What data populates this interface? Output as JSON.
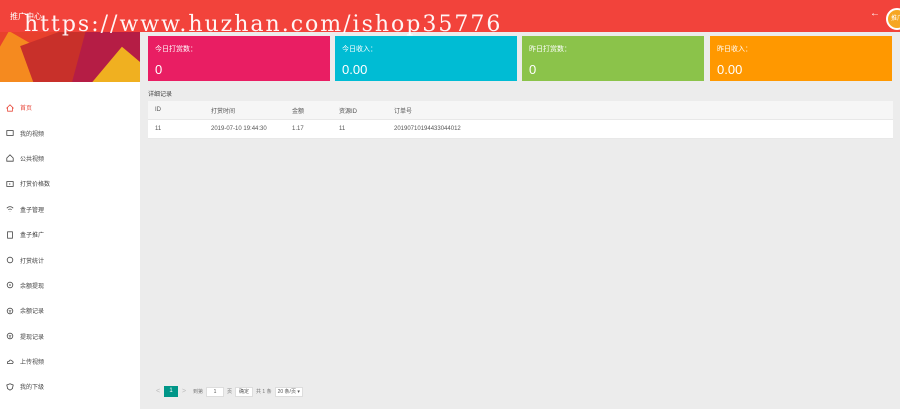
{
  "header": {
    "title": "推广中心",
    "back_icon": "←",
    "avatar_text": "推广",
    "accent": "#f2433b"
  },
  "watermark": "https://www.huzhan.com/ishop35776",
  "sidebar": {
    "items": [
      {
        "label": "首页",
        "icon": "home-icon"
      },
      {
        "label": "我的视频",
        "icon": "video-icon"
      },
      {
        "label": "公共视频",
        "icon": "public-video-icon"
      },
      {
        "label": "打赏价格数",
        "icon": "price-icon"
      },
      {
        "label": "盒子管理",
        "icon": "box-manage-icon"
      },
      {
        "label": "盒子推广",
        "icon": "box-promo-icon"
      },
      {
        "label": "打赏统计",
        "icon": "stats-icon"
      },
      {
        "label": "余额提现",
        "icon": "withdraw-icon"
      },
      {
        "label": "余额记录",
        "icon": "balance-icon"
      },
      {
        "label": "提现记录",
        "icon": "withdraw-record-icon"
      },
      {
        "label": "上传视频",
        "icon": "upload-icon"
      },
      {
        "label": "我的下级",
        "icon": "subordinate-icon"
      }
    ]
  },
  "stats": [
    {
      "label": "今日打赏数：",
      "value": "0",
      "color": "#e91e63"
    },
    {
      "label": "今日收入：",
      "value": "0.00",
      "color": "#00bcd4"
    },
    {
      "label": "昨日打赏数：",
      "value": "0",
      "color": "#8bc34a"
    },
    {
      "label": "昨日收入：",
      "value": "0.00",
      "color": "#ff9800"
    }
  ],
  "table": {
    "title": "详细记录",
    "columns": [
      "ID",
      "打赏时间",
      "金额",
      "资源ID",
      "订单号"
    ],
    "rows": [
      [
        "11",
        "2019-07-10 19:44:30",
        "1.17",
        "11",
        "20190710194433044012"
      ]
    ]
  },
  "pagination": {
    "prev": "<",
    "current": "1",
    "next": ">",
    "goto_label": "到第",
    "goto_value": "1",
    "page_suffix": "页",
    "confirm": "确定",
    "total": "共 1 条",
    "per_page": "20 条/页"
  }
}
